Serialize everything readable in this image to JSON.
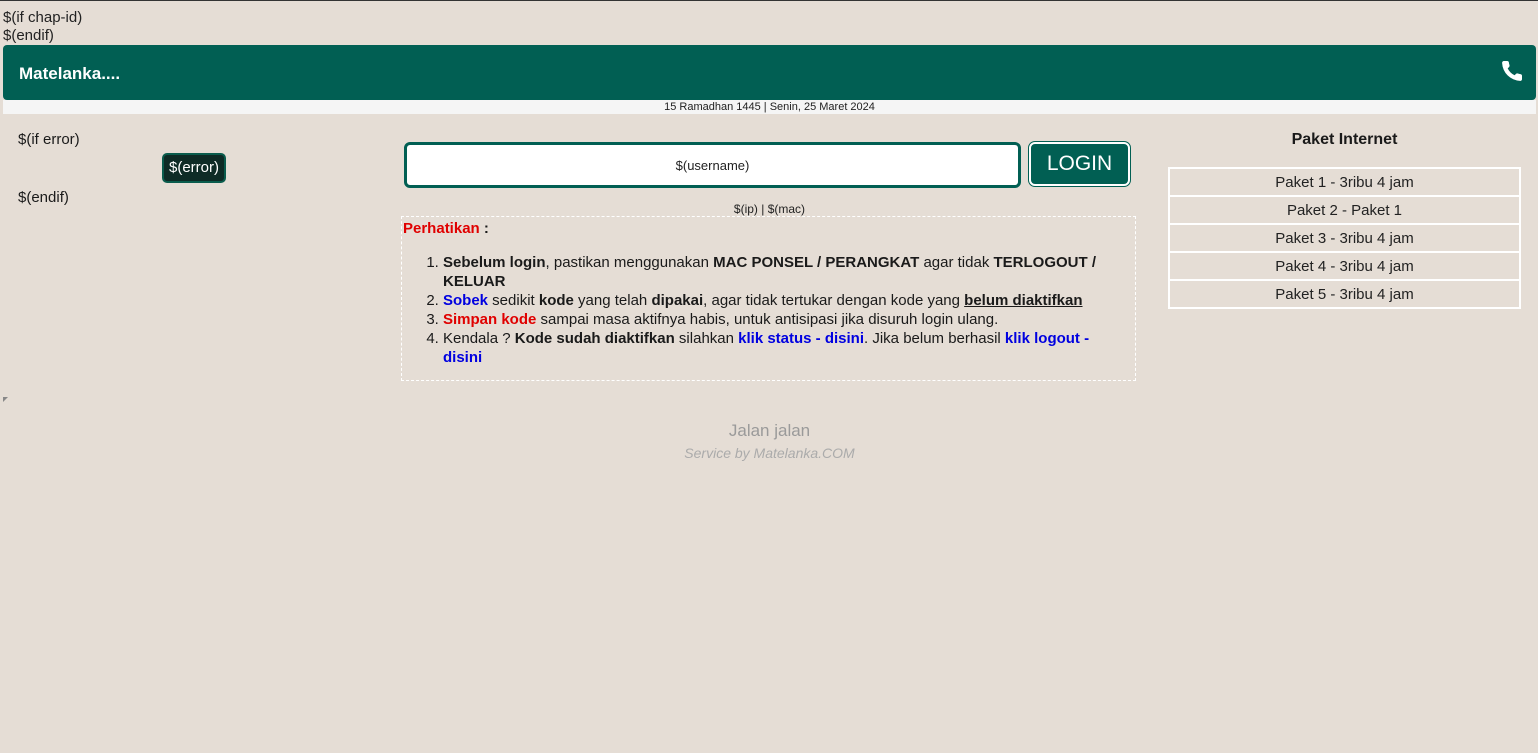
{
  "template_lines": {
    "if_chap": "$(if chap-id)",
    "endif": "$(endif)"
  },
  "header": {
    "brand": "Matelanka....",
    "phone_icon": "phone-icon",
    "bg_color": "#015f53"
  },
  "date": {
    "hijri": "15 Ramadhan 1445",
    "separator": " | ",
    "gregorian": "Senin, 25 Maret 2024"
  },
  "left": {
    "if_error": "$(if error)",
    "error": "$(error)",
    "endif": "$(endif)"
  },
  "login": {
    "username_placeholder": "$(username)",
    "button_label": "LOGIN",
    "ipmac": "$(ip) | $(mac)"
  },
  "notice": {
    "title": "Perhatikan",
    "colon": " :",
    "items": [
      {
        "a_bold": "Sebelum login",
        "a_rest": ", pastikan menggunakan ",
        "b_bold": "MAC PONSEL / PERANGKAT",
        "b_rest": " agar tidak ",
        "c_bold": "TERLOGOUT / KELUAR"
      },
      {
        "a_blue": "Sobek",
        "a_rest": " sedikit ",
        "b_bold": "kode",
        "b_rest": " yang telah ",
        "c_bold": "dipakai",
        "c_rest": ", agar tidak tertukar dengan kode yang ",
        "d_uline": "belum diaktifkan"
      },
      {
        "a_red": "Simpan kode",
        "a_rest": " sampai masa aktifnya habis, untuk antisipasi jika disuruh login ulang."
      },
      {
        "a_plain": "Kendala ? ",
        "b_bold": "Kode sudah diaktifkan",
        "b_rest": " silahkan ",
        "link_status": "klik status - disini",
        "mid": ". Jika belum berhasil ",
        "link_logout": "klik logout - disini"
      }
    ]
  },
  "paket": {
    "title": "Paket Internet",
    "items": [
      "Paket 1 - 3ribu 4 jam",
      "Paket 2 - Paket 1",
      "Paket 3 - 3ribu 4 jam",
      "Paket 4 - 3ribu 4 jam",
      "Paket 5 - 3ribu 4 jam"
    ]
  },
  "footer": {
    "line1": "Jalan jalan",
    "line2": "Service by Matelanka.COM"
  }
}
